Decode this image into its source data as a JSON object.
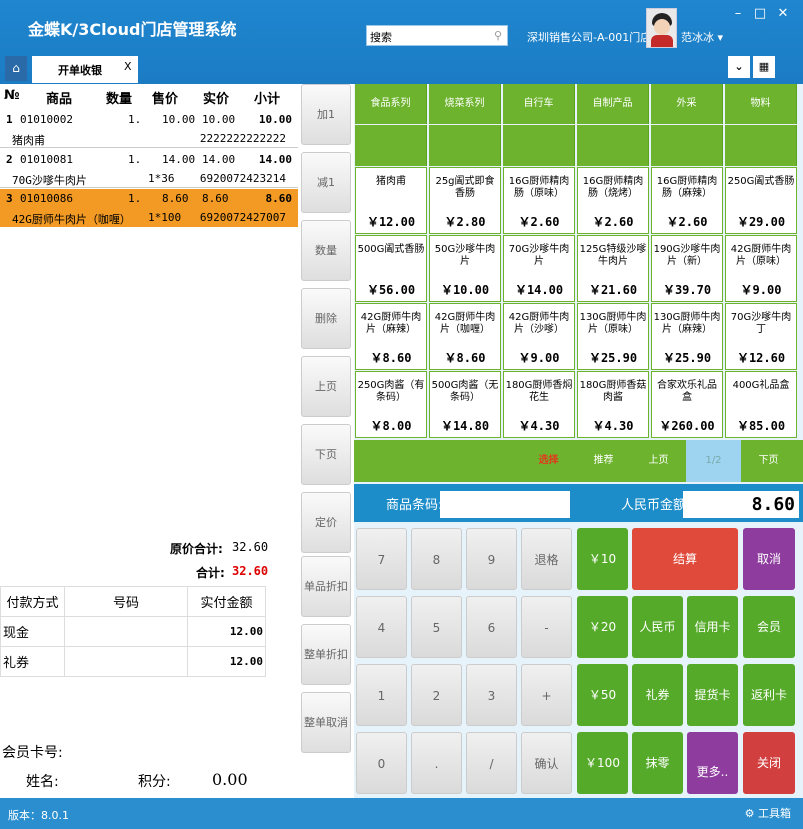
{
  "app": {
    "title": "金蝶K/3Cloud门店管理系统",
    "search_placeholder": "搜索",
    "company": "深圳销售公司-A-001门店",
    "user": "范冰冰 ▾",
    "version": "版本：8.0.1",
    "toolbox": "工具箱"
  },
  "tabs": {
    "home": "⌂",
    "active": "开单收银",
    "close": "X"
  },
  "cart": {
    "headers": {
      "no": "№",
      "item": "商品",
      "qty": "数量",
      "price": "售价",
      "actual": "实价",
      "subtotal": "小计"
    },
    "rows": [
      {
        "idx": "1",
        "code": "01010002",
        "qty": "1.",
        "price": "10.00",
        "actual": "10.00",
        "subtotal": "10.00",
        "name": "猪肉甫",
        "spec": "",
        "barcode": "2222222222222"
      },
      {
        "idx": "2",
        "code": "01010081",
        "qty": "1.",
        "price": "14.00",
        "actual": "14.00",
        "subtotal": "14.00",
        "name": "70G沙嗲牛肉片",
        "spec": "1*36",
        "barcode": "6920072423214"
      },
      {
        "idx": "3",
        "code": "01010086",
        "qty": "1.",
        "price": "8.60",
        "actual": "8.60",
        "subtotal": "8.60",
        "name": "42G厨师牛肉片（咖喱）",
        "spec": "1*100",
        "barcode": "6920072427007"
      }
    ],
    "orig_total_label": "原价合计:",
    "orig_total": "32.60",
    "total_label": "合计:",
    "total": "32.60"
  },
  "payment": {
    "headers": [
      "付款方式",
      "号码",
      "实付金额"
    ],
    "rows": [
      [
        "现金",
        "",
        "12.00"
      ],
      [
        "礼券",
        "",
        "12.00"
      ]
    ]
  },
  "member": {
    "card_label": "会员卡号:",
    "name_label": "姓名:",
    "points_label": "积分:",
    "points": "0.00"
  },
  "side_buttons": [
    "加1",
    "减1",
    "数量",
    "删除",
    "上页",
    "下页",
    "定价",
    "单品折扣",
    "整单折扣",
    "整单取消"
  ],
  "categories": [
    "食品系列",
    "烧菜系列",
    "自行车",
    "自制产品",
    "外采",
    "物料"
  ],
  "products": [
    {
      "name": "猪肉甫",
      "price": "￥12.00"
    },
    {
      "name": "25g阖式即食香肠",
      "price": "￥2.80"
    },
    {
      "name": "16G厨师精肉肠（原味）",
      "price": "￥2.60"
    },
    {
      "name": "16G厨师精肉肠（烧烤）",
      "price": "￥2.60"
    },
    {
      "name": "16G厨师精肉肠（麻辣）",
      "price": "￥2.60"
    },
    {
      "name": "250G阖式香肠",
      "price": "￥29.00"
    },
    {
      "name": "500G阖式香肠",
      "price": "￥56.00"
    },
    {
      "name": "50G沙嗲牛肉片",
      "price": "￥10.00"
    },
    {
      "name": "70G沙嗲牛肉片",
      "price": "￥14.00"
    },
    {
      "name": "125G特级沙嗲牛肉片",
      "price": "￥21.60"
    },
    {
      "name": "190G沙嗲牛肉片（新）",
      "price": "￥39.70"
    },
    {
      "name": "42G厨师牛肉片（原味）",
      "price": "￥9.00"
    },
    {
      "name": "42G厨师牛肉片（麻辣）",
      "price": "￥8.60"
    },
    {
      "name": "42G厨师牛肉片（咖喱）",
      "price": "￥8.60"
    },
    {
      "name": "42G厨师牛肉片（沙嗲）",
      "price": "￥9.00"
    },
    {
      "name": "130G厨师牛肉片（原味）",
      "price": "￥25.90"
    },
    {
      "name": "130G厨师牛肉片（麻辣）",
      "price": "￥25.90"
    },
    {
      "name": "70G沙嗲牛肉丁",
      "price": "￥12.60"
    },
    {
      "name": "250G肉酱（有条码）",
      "price": "￥8.00"
    },
    {
      "name": "500G肉酱（无条码）",
      "price": "￥14.80"
    },
    {
      "name": "180G厨师香焖花生",
      "price": "￥4.30"
    },
    {
      "name": "180G厨师香菇肉酱",
      "price": "￥4.30"
    },
    {
      "name": "合家欢乐礼品盒",
      "price": "￥260.00"
    },
    {
      "name": "400G礼品盒",
      "price": "￥85.00"
    }
  ],
  "nav": {
    "select": "选择",
    "recommend": "推荐",
    "prev": "上页",
    "page": "1/2",
    "next": "下页"
  },
  "barcode_label": "商品条码:",
  "amount_label": "人民币金额",
  "amount": "8.60",
  "keypad": {
    "k7": "7",
    "k8": "8",
    "k9": "9",
    "back": "退格",
    "m10": "￥10",
    "settle": "结算",
    "cancel": "取消",
    "k4": "4",
    "k5": "5",
    "k6": "6",
    "minus": "-",
    "m20": "￥20",
    "rmb": "人民币",
    "credit": "信用卡",
    "member": "会员",
    "k1": "1",
    "k2": "2",
    "k3": "3",
    "plus": "+",
    "m50": "￥50",
    "gift": "礼券",
    "pickup": "提货卡",
    "rebate": "返利卡",
    "k0": "0",
    "dot": ".",
    "slash": "/",
    "confirm": "确认",
    "m100": "￥100",
    "wipe": "抹零",
    "more": "更多..",
    "close": "关闭"
  }
}
